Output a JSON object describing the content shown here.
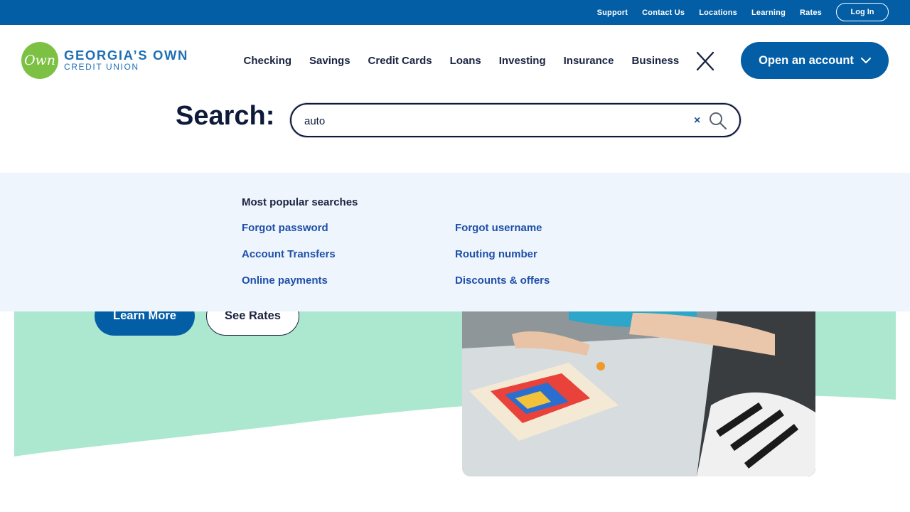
{
  "utility": {
    "links": [
      "Support",
      "Contact Us",
      "Locations",
      "Learning",
      "Rates"
    ],
    "login_label": "Log In"
  },
  "brand": {
    "logo_mark": "Own",
    "name_line1": "GEORGIA’S OWN",
    "name_line2": "CREDIT UNION",
    "primary_color": "#035ea6",
    "logo_green": "#7cc144"
  },
  "nav": {
    "items": [
      "Checking",
      "Savings",
      "Credit Cards",
      "Loans",
      "Investing",
      "Insurance",
      "Business"
    ],
    "close_icon": "close-icon",
    "open_account_label": "Open an account"
  },
  "search": {
    "label": "Search:",
    "value": "auto",
    "clear_symbol": "×"
  },
  "popular": {
    "title": "Most popular searches",
    "left": [
      "Forgot password",
      "Account Transfers",
      "Online payments"
    ],
    "right": [
      "Forgot username",
      "Routing number",
      "Discounts & offers"
    ]
  },
  "hero": {
    "learn_more_label": "Learn More",
    "see_rates_label": "See Rates",
    "accent_color": "#ace8cf"
  }
}
